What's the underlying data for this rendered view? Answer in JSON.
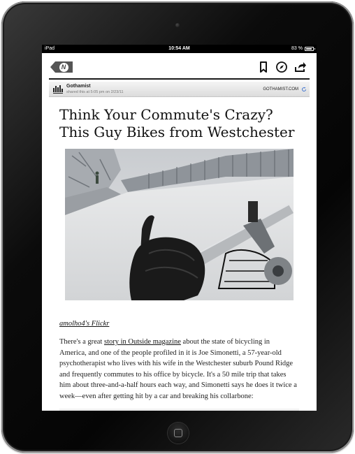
{
  "status_bar": {
    "device": "iPad",
    "time": "10:54 AM",
    "battery": "83 %"
  },
  "toolbar": {
    "back_logo": "N"
  },
  "source": {
    "name": "Gothamist",
    "logo_caption": "gothamist",
    "shared_info": "shared this at 5:05 pm on 2/23/11",
    "domain": "GOTHAMIST.COM"
  },
  "article": {
    "title": "Think Your Commute's Crazy? This Guy Bikes from Westchester",
    "photo_credit": "amolho4's Flickr",
    "body_before_link": "There's a great ",
    "link_text": "story in Outside magazine",
    "body_after_link": " about the state of bicycling in America, and one of the people profiled in it is Joe Simonetti, a 57-year-old psychotherapist who lives with his wife in the Westchester suburb Pound Ridge and frequently commutes to his office by bicycle. It's a 50 mile trip that takes him about three-and-a-half hours each way, and Simonetti says he does it twice a week—even after getting hit by a car and breaking his collarbone:"
  },
  "colors": {
    "device_frame": "#0b0b0b",
    "status_bar": "#000000",
    "back_button": "#555555",
    "source_bar": "#e6e6e6",
    "link_accent": "#111111"
  }
}
